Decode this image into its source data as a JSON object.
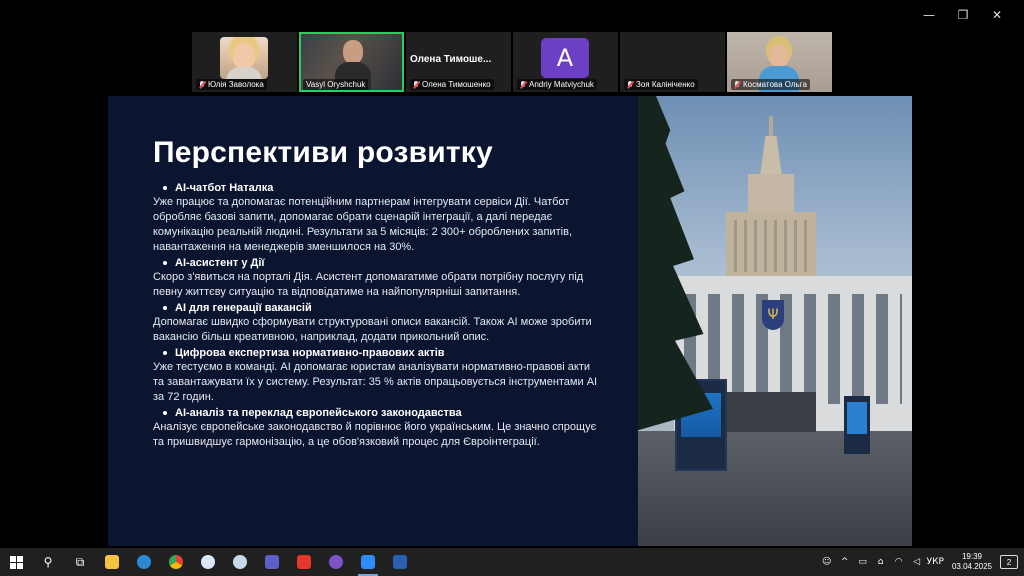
{
  "window": {
    "controls": [
      "—",
      "❐",
      "✕"
    ]
  },
  "participants": [
    {
      "name": "Юлія Заволока",
      "type": "photo"
    },
    {
      "name": "Vasyl Oryshchuk",
      "type": "camera",
      "active": true
    },
    {
      "name": "Олена Тимошенко",
      "type": "name",
      "display_name": "Олена  Тимоше..."
    },
    {
      "name": "Andriy Matviychuk",
      "type": "avatar",
      "initial": "A"
    },
    {
      "name": "Зоя Калініченко",
      "type": "empty"
    },
    {
      "name": "Косматова Ольга",
      "type": "photo"
    }
  ],
  "slide": {
    "title": "Перспективи розвитку",
    "items": [
      {
        "heading": "AI-чатбот Наталка",
        "body": "Уже працює та допомагає потенційним партнерам інтегрувати сервіси Дії. Чатбот обробляє базові запити, допомагає обрати сценарій інтеграції, а далі передає комунікацію реальній людині. Результати за 5 місяців: 2 300+ оброблених запитів, навантаження на менеджерів зменшилося на 30%."
      },
      {
        "heading": "AI-асистент у Дії",
        "body": "Скоро з'явиться на порталі Дія. Асистент допомагатиме обрати потрібну послугу під певну життєву ситуацію та відповідатиме на найпопулярніші запитання."
      },
      {
        "heading": "AI для генерації вакансій",
        "body": "Допомагає швидко сформувати структуровані описи вакансій. Також AI може зробити вакансію більш креативною, наприклад, додати прикольний опис."
      },
      {
        "heading": "Цифрова експертиза нормативно-правових актів",
        "body": "Уже тестуємо в команді. AI допомагає юристам аналізувати нормативно-правові акти та завантажувати їх у систему. Результат: 35 % актів опрацьовується інструментами AI за 72 годин."
      },
      {
        "heading": "AI-аналіз та переклад європейського законодавства",
        "body": "Аналізує європейське законодавство й порівнює його українським. Це значно спрощує та пришвидшує гармонізацію, а це обов'язковий процес для Євроінтеграції."
      }
    ]
  },
  "taskbar": {
    "apps": [
      "start",
      "search",
      "task-view",
      "file-explorer",
      "edge",
      "chrome",
      "paint",
      "paint-alt",
      "teams",
      "anydesk",
      "viber",
      "zoom",
      "word"
    ],
    "active_app": "zoom",
    "tray": {
      "language": "УКР",
      "time": "19:39",
      "date": "03.04.2025",
      "notifications": "2"
    }
  }
}
